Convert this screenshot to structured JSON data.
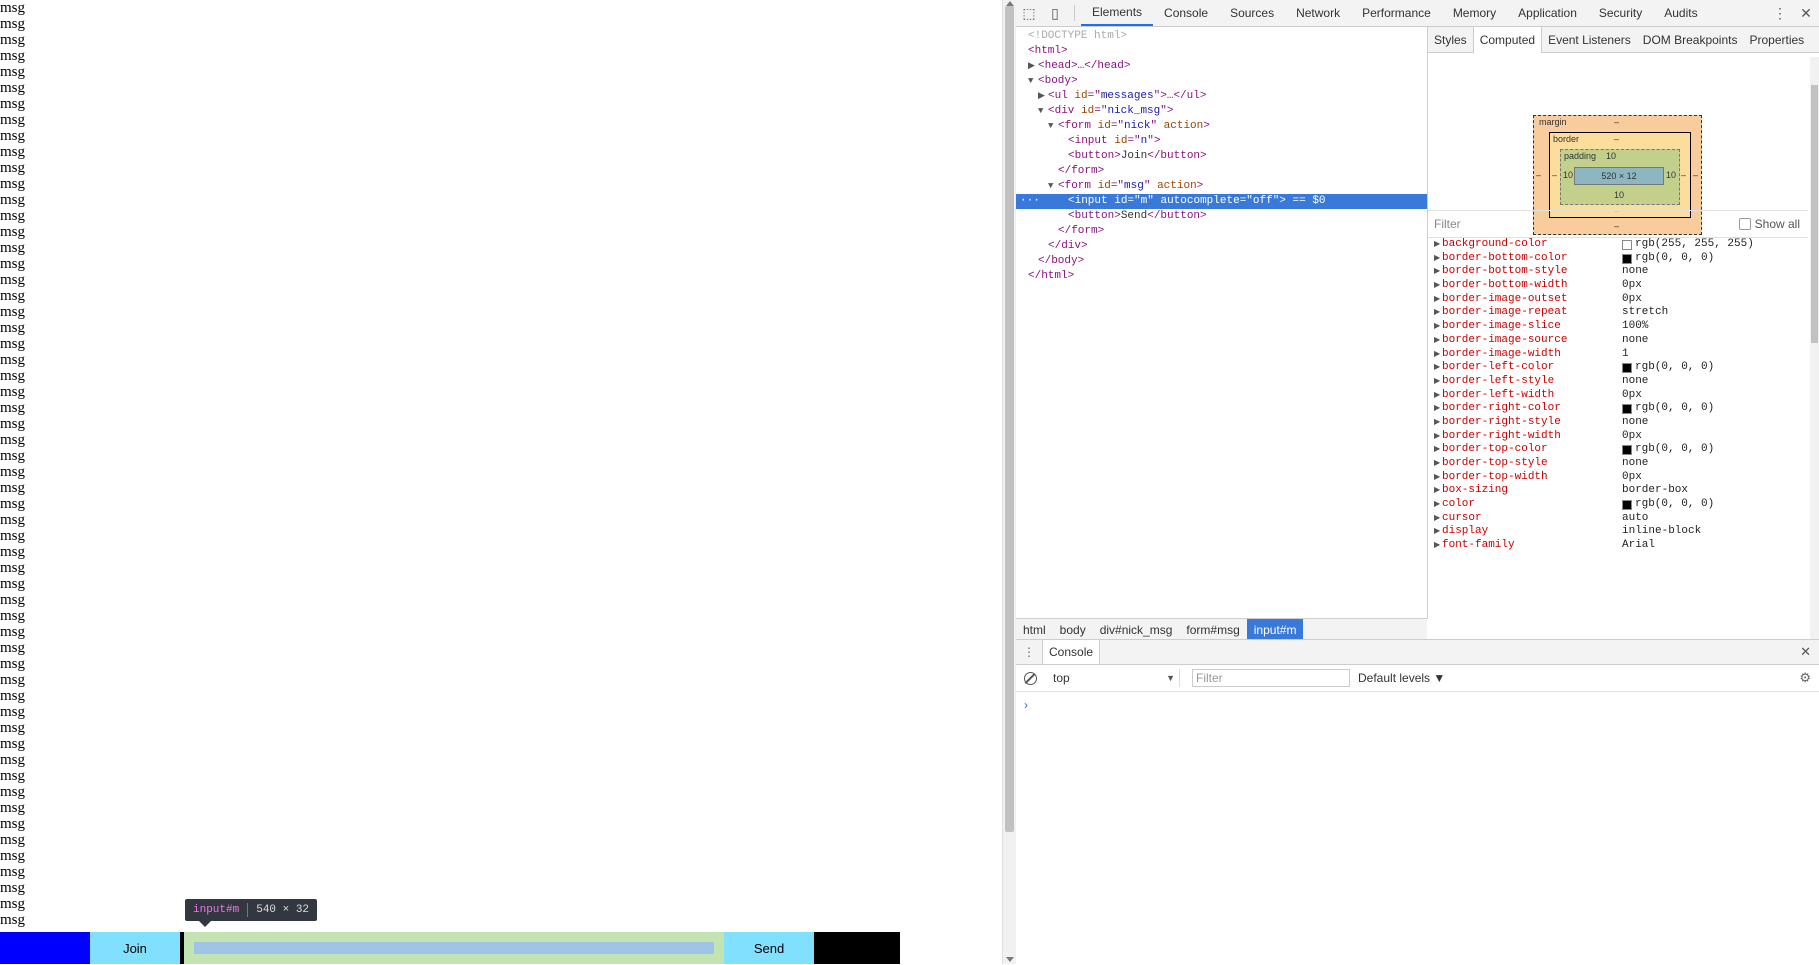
{
  "page": {
    "messages": [
      "msg",
      "msg",
      "msg",
      "msg",
      "msg",
      "msg",
      "msg",
      "msg",
      "msg",
      "msg",
      "msg",
      "msg",
      "msg",
      "msg",
      "msg",
      "msg",
      "msg",
      "msg",
      "msg",
      "msg",
      "msg",
      "msg",
      "msg",
      "msg",
      "msg",
      "msg",
      "msg",
      "msg",
      "msg",
      "msg",
      "msg",
      "msg",
      "msg",
      "msg",
      "msg",
      "msg",
      "msg",
      "msg",
      "msg",
      "msg",
      "msg",
      "msg",
      "msg",
      "msg",
      "msg",
      "msg",
      "msg",
      "msg",
      "msg",
      "msg",
      "msg",
      "msg",
      "msg",
      "msg",
      "msg",
      "msg",
      "msg",
      "msg"
    ],
    "join_label": "Join",
    "send_label": "Send",
    "tooltip": {
      "name": "input#m",
      "size": "540 × 32"
    }
  },
  "devtools": {
    "tabs": [
      "Elements",
      "Console",
      "Sources",
      "Network",
      "Performance",
      "Memory",
      "Application",
      "Security",
      "Audits"
    ],
    "active_tab": "Elements",
    "dom": {
      "doctype": "<!DOCTYPE html>",
      "html_open": "<html>",
      "head": "<head>…</head>",
      "body_open": "<body>",
      "ul_messages": {
        "tag": "ul",
        "attr": "id",
        "val": "messages",
        "rest": ">…</ul>"
      },
      "div_nick_msg": {
        "tag": "div",
        "attr": "id",
        "val": "nick_msg"
      },
      "form_nick": {
        "tag": "form",
        "attr1": "id",
        "val1": "nick",
        "attr2": "action"
      },
      "input_n": {
        "tag": "input",
        "attr": "id",
        "val": "n"
      },
      "button_join": {
        "open": "<button>",
        "text": "Join",
        "close": "</button>"
      },
      "form_close": "</form>",
      "form_msg": {
        "tag": "form",
        "attr1": "id",
        "val1": "msg",
        "attr2": "action"
      },
      "input_m": {
        "tag": "input",
        "attr1": "id",
        "val1": "m",
        "attr2": "autocomplete",
        "val2": "off",
        "eq": "== $0"
      },
      "button_send": {
        "open": "<button>",
        "text": "Send",
        "close": "</button>"
      },
      "div_close": "</div>",
      "body_close": "</body>",
      "html_close": "</html>"
    },
    "breadcrumbs": [
      "html",
      "body",
      "div#nick_msg",
      "form#msg",
      "input#m"
    ],
    "sidebar_tabs": [
      "Styles",
      "Computed",
      "Event Listeners",
      "DOM Breakpoints",
      "Properties"
    ],
    "active_sidebar_tab": "Computed",
    "box_model": {
      "margin_label": "margin",
      "margin_top": "–",
      "margin_bottom": "–",
      "margin_left": "–",
      "margin_right": "–",
      "border_label": "border",
      "border_top": "–",
      "border_bottom": "–",
      "border_left": "–",
      "border_right": "–",
      "padding_label": "padding",
      "padding_top": "10",
      "padding_bottom": "10",
      "padding_left": "10",
      "padding_right": "10",
      "content": "520 × 12"
    },
    "filter_placeholder": "Filter",
    "show_all_label": "Show all",
    "computed": [
      {
        "name": "background-color",
        "value": "rgb(255, 255, 255)",
        "swatch": "#ffffff"
      },
      {
        "name": "border-bottom-color",
        "value": "rgb(0, 0, 0)",
        "swatch": "#000000"
      },
      {
        "name": "border-bottom-style",
        "value": "none"
      },
      {
        "name": "border-bottom-width",
        "value": "0px"
      },
      {
        "name": "border-image-outset",
        "value": "0px"
      },
      {
        "name": "border-image-repeat",
        "value": "stretch"
      },
      {
        "name": "border-image-slice",
        "value": "100%"
      },
      {
        "name": "border-image-source",
        "value": "none"
      },
      {
        "name": "border-image-width",
        "value": "1"
      },
      {
        "name": "border-left-color",
        "value": "rgb(0, 0, 0)",
        "swatch": "#000000"
      },
      {
        "name": "border-left-style",
        "value": "none"
      },
      {
        "name": "border-left-width",
        "value": "0px"
      },
      {
        "name": "border-right-color",
        "value": "rgb(0, 0, 0)",
        "swatch": "#000000"
      },
      {
        "name": "border-right-style",
        "value": "none"
      },
      {
        "name": "border-right-width",
        "value": "0px"
      },
      {
        "name": "border-top-color",
        "value": "rgb(0, 0, 0)",
        "swatch": "#000000"
      },
      {
        "name": "border-top-style",
        "value": "none"
      },
      {
        "name": "border-top-width",
        "value": "0px"
      },
      {
        "name": "box-sizing",
        "value": "border-box"
      },
      {
        "name": "color",
        "value": "rgb(0, 0, 0)",
        "swatch": "#000000"
      },
      {
        "name": "cursor",
        "value": "auto"
      },
      {
        "name": "display",
        "value": "inline-block"
      },
      {
        "name": "font-family",
        "value": "Arial"
      }
    ],
    "drawer": {
      "tab": "Console",
      "context": "top",
      "filter_placeholder": "Filter",
      "levels": "Default levels ▼",
      "prompt": "›"
    }
  },
  "colors": {
    "nick_input": "#0000ff",
    "buttons": "#82e0ff",
    "padding_highlight": "#c3e3b2",
    "content_highlight": "#9fc4e6",
    "selection": "#3879d9"
  }
}
